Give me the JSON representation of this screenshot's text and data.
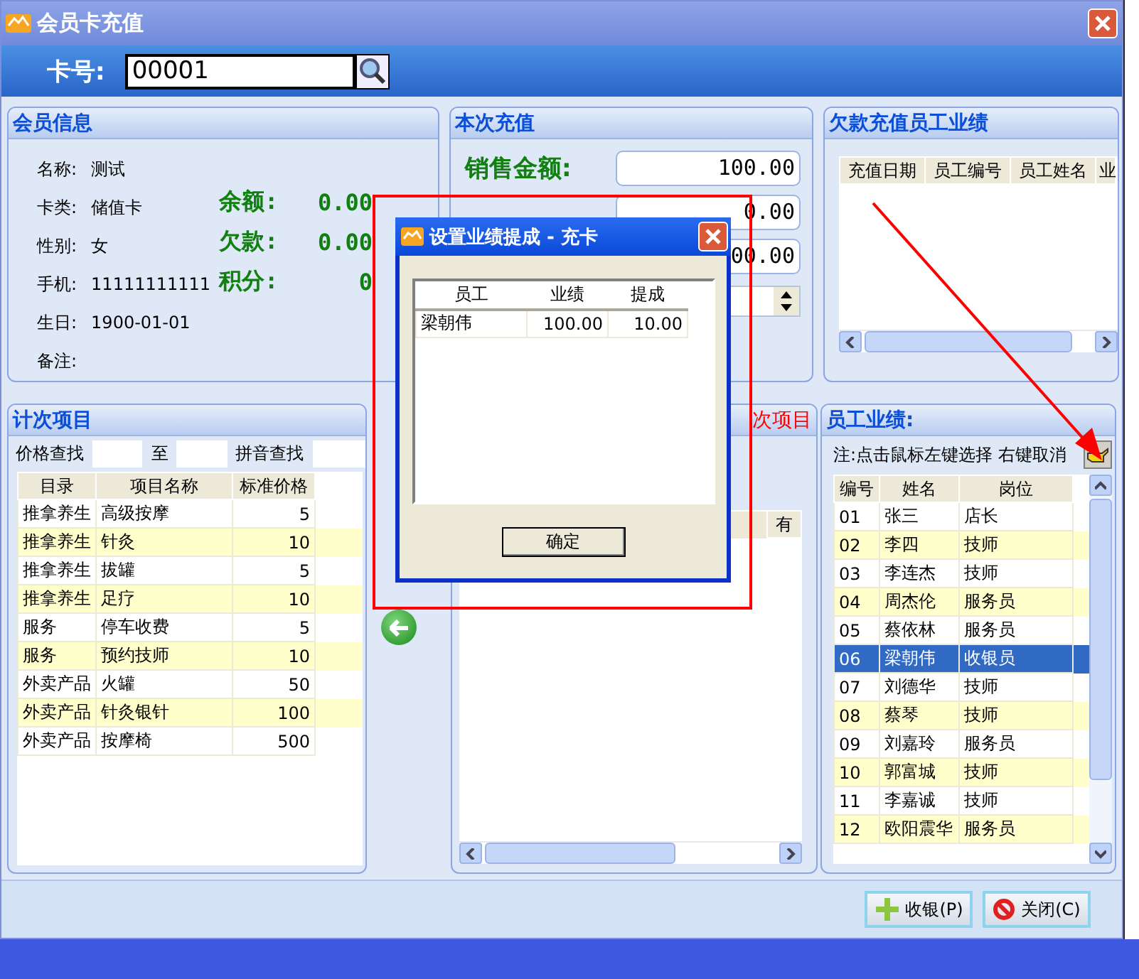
{
  "window": {
    "title": "会员卡充值"
  },
  "card": {
    "label": "卡号:",
    "value": "00001"
  },
  "member_info": {
    "title": "会员信息",
    "fields": [
      {
        "label": "名称:",
        "value": "测试"
      },
      {
        "label": "卡类:",
        "value": "储值卡"
      },
      {
        "label": "性别:",
        "value": "女"
      },
      {
        "label": "手机:",
        "value": "11111111111"
      },
      {
        "label": "生日:",
        "value": "1900-01-01"
      },
      {
        "label": "备注:"
      }
    ],
    "balances": [
      {
        "label": "余额:",
        "value": "0.00"
      },
      {
        "label": "欠款:",
        "value": "0.00"
      },
      {
        "label": "积分:",
        "value": "0"
      }
    ]
  },
  "recharge": {
    "title": "本次充值",
    "fields": [
      {
        "label": "销售金额:",
        "value": "100.00"
      },
      {
        "value": "0.00"
      },
      {
        "value": "00.00"
      }
    ]
  },
  "debt_staff": {
    "title": "欠款充值员工业绩",
    "columns": [
      "充值日期",
      "员工编号",
      "员工姓名",
      "业"
    ]
  },
  "count_items": {
    "title": "计次项目",
    "price_search": "价格查找",
    "to": "至",
    "pinyin_search": "拼音查找",
    "columns": [
      "目录",
      "项目名称",
      "标准价格"
    ],
    "rows": [
      [
        "推拿养生",
        "高级按摩",
        "5"
      ],
      [
        "推拿养生",
        "针灸",
        "10"
      ],
      [
        "推拿养生",
        "拔罐",
        "5"
      ],
      [
        "推拿养生",
        "足疗",
        "10"
      ],
      [
        "服务",
        "停车收费",
        "5"
      ],
      [
        "服务",
        "预约技师",
        "10"
      ],
      [
        "外卖产品",
        "火罐",
        "50"
      ],
      [
        "外卖产品",
        "针灸银针",
        "100"
      ],
      [
        "外卖产品",
        "按摩椅",
        "500"
      ]
    ]
  },
  "selected_items": {
    "title": "次项目",
    "columns": [
      "有"
    ]
  },
  "staff": {
    "title": "员工业绩:",
    "note": "注:点击鼠标左键选择 右键取消",
    "columns": [
      "编号",
      "姓名",
      "岗位"
    ],
    "rows": [
      {
        "cells": [
          "01",
          "张三",
          "店长"
        ],
        "selected": false
      },
      {
        "cells": [
          "02",
          "李四",
          "技师"
        ],
        "selected": false
      },
      {
        "cells": [
          "03",
          "李连杰",
          "技师"
        ],
        "selected": false
      },
      {
        "cells": [
          "04",
          "周杰伦",
          "服务员"
        ],
        "selected": false
      },
      {
        "cells": [
          "05",
          "蔡依林",
          "服务员"
        ],
        "selected": false
      },
      {
        "cells": [
          "06",
          "梁朝伟",
          "收银员"
        ],
        "selected": true
      },
      {
        "cells": [
          "07",
          "刘德华",
          "技师"
        ],
        "selected": false
      },
      {
        "cells": [
          "08",
          "蔡琴",
          "技师"
        ],
        "selected": false
      },
      {
        "cells": [
          "09",
          "刘嘉玲",
          "服务员"
        ],
        "selected": false
      },
      {
        "cells": [
          "10",
          "郭富城",
          "技师"
        ],
        "selected": false
      },
      {
        "cells": [
          "11",
          "李嘉诚",
          "技师"
        ],
        "selected": false
      },
      {
        "cells": [
          "12",
          "欧阳震华",
          "服务员"
        ],
        "selected": false
      }
    ]
  },
  "buttons": [
    {
      "label": "收银(P)",
      "kind": "checkout"
    },
    {
      "label": "关闭(C)",
      "kind": "close"
    }
  ],
  "dialog": {
    "title": "设置业绩提成 - 充卡",
    "columns": [
      "员工",
      "业绩",
      "提成"
    ],
    "rows": [
      [
        "梁朝伟",
        "100.00",
        "10.00"
      ]
    ],
    "button": "确定"
  }
}
